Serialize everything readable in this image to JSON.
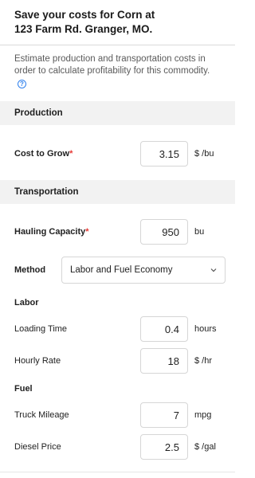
{
  "header": {
    "title_line1": "Save your costs for Corn at",
    "title_line2": "123 Farm Rd. Granger, MO."
  },
  "intro": {
    "text": "Estimate production and transportation costs in order to calculate profitability for this commodity.",
    "help_glyph": "?"
  },
  "production": {
    "section_title": "Production",
    "cost_to_grow": {
      "label": "Cost to Grow",
      "required": "*",
      "value": "3.15",
      "unit": "$ /bu"
    }
  },
  "transportation": {
    "section_title": "Transportation",
    "hauling_capacity": {
      "label": "Hauling Capacity",
      "required": "*",
      "value": "950",
      "unit": "bu"
    },
    "method": {
      "label": "Method",
      "selected": "Labor and Fuel Economy"
    }
  },
  "labor": {
    "title": "Labor",
    "loading_time": {
      "label": "Loading Time",
      "value": "0.4",
      "unit": "hours"
    },
    "hourly_rate": {
      "label": "Hourly Rate",
      "value": "18",
      "unit": "$ /hr"
    }
  },
  "fuel": {
    "title": "Fuel",
    "truck_mileage": {
      "label": "Truck Mileage",
      "value": "7",
      "unit": "mpg"
    },
    "diesel_price": {
      "label": "Diesel Price",
      "value": "2.5",
      "unit": "$ /gal"
    }
  },
  "colors": {
    "required": "#e53935",
    "help": "#2f80ed",
    "section_bg": "#f2f2f2",
    "border": "#d6d6d6"
  }
}
